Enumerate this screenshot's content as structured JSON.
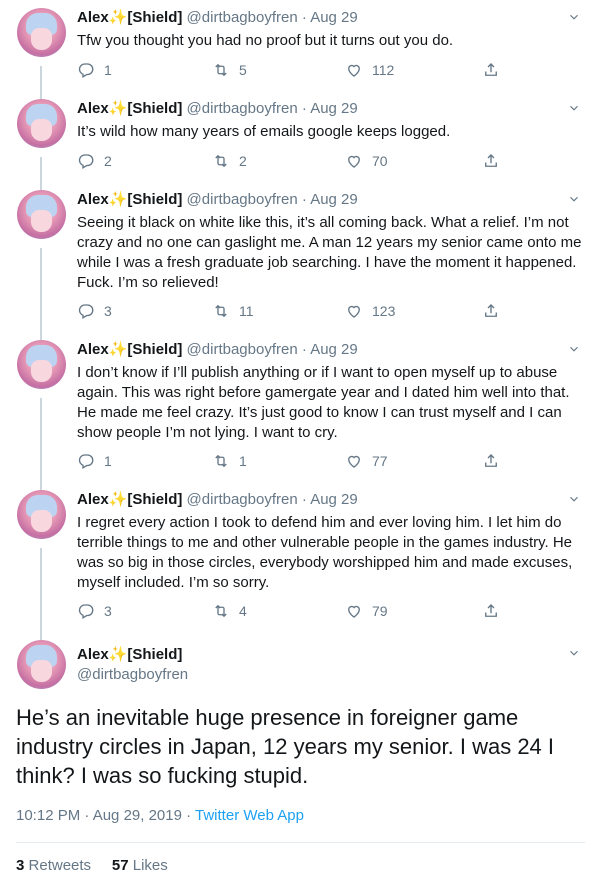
{
  "author": {
    "name": "Alex",
    "badge": "✨",
    "tag": "[Shield]",
    "handle": "@dirtbagboyfren"
  },
  "tweets": [
    {
      "date": "Aug 29",
      "text": "Tfw you thought you had no proof but it turns out you do.",
      "replies": "1",
      "retweets": "5",
      "likes": "112"
    },
    {
      "date": "Aug 29",
      "text": "It’s wild how many years of emails google keeps logged.",
      "replies": "2",
      "retweets": "2",
      "likes": "70"
    },
    {
      "date": "Aug 29",
      "text": "Seeing it black on white like this, it’s all coming back. What a relief. I’m not crazy and no one can gaslight me. A man 12 years my senior came onto me while I was a fresh graduate job searching. I have the moment it happened. Fuck. I’m so relieved!",
      "replies": "3",
      "retweets": "11",
      "likes": "123"
    },
    {
      "date": "Aug 29",
      "text": "I don’t know if I’ll publish anything or if I want to open myself up to abuse again. This was right before gamergate year and I dated him well into that. He made me feel crazy. It’s just good to know I can trust myself and I can show people I’m not lying. I want to cry.",
      "replies": "1",
      "retweets": "1",
      "likes": "77"
    },
    {
      "date": "Aug 29",
      "text": "I regret every action I took to defend him and ever loving him. I let him do terrible things to me and other vulnerable people in the games industry. He was so big in those circles, everybody worshipped him and made excuses, myself included. I’m so sorry.",
      "replies": "3",
      "retweets": "4",
      "likes": "79"
    }
  ],
  "main_tweet": {
    "text": "He’s an inevitable huge presence in foreigner game industry circles in Japan, 12 years my senior. I was 24 I think? I was so fucking stupid.",
    "time": "10:12 PM · Aug 29, 2019 · ",
    "app": "Twitter Web App",
    "retweets_count": "3",
    "retweets_label": "Retweets",
    "likes_count": "57",
    "likes_label": "Likes"
  },
  "icons": [
    "reply-icon",
    "retweet-icon",
    "like-icon",
    "share-icon",
    "chevron-down-icon"
  ],
  "colors": {
    "text": "#14171a",
    "secondary": "#657786",
    "link": "#1da1f2",
    "divider": "#e6ecf0",
    "badge": "#ffad1f"
  }
}
